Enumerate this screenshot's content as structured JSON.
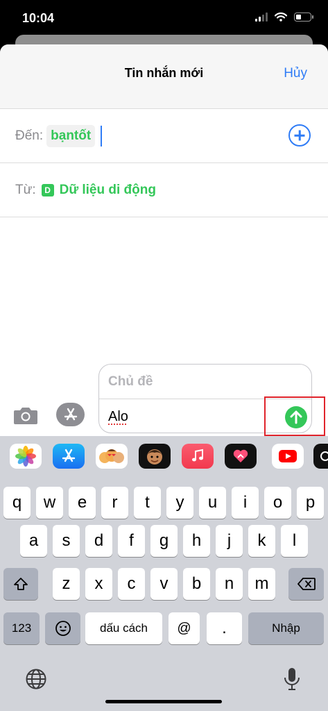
{
  "status_bar": {
    "time": "10:04"
  },
  "nav": {
    "title": "Tin nhắn mới",
    "cancel_label": "Hủy"
  },
  "to_field": {
    "label": "Đến:",
    "recipient": "bạntốt"
  },
  "from_field": {
    "label": "Từ:",
    "sim_badge": "D",
    "sim_name": "Dữ liệu di động"
  },
  "compose": {
    "subject_placeholder": "Chủ đề",
    "message_text": "Alo"
  },
  "keyboard": {
    "row1": [
      "q",
      "w",
      "e",
      "r",
      "t",
      "y",
      "u",
      "i",
      "o",
      "p"
    ],
    "row2": [
      "a",
      "s",
      "d",
      "f",
      "g",
      "h",
      "j",
      "k",
      "l"
    ],
    "row3": [
      "z",
      "x",
      "c",
      "v",
      "b",
      "n",
      "m"
    ],
    "numbers_label": "123",
    "space_label": "dấu cách",
    "at_label": "@",
    "dot_label": ".",
    "return_label": "Nhập"
  },
  "app_strip": [
    "photos-icon",
    "app-store-icon",
    "memoji-stickers-icon",
    "memoji-icon",
    "music-icon",
    "digital-touch-icon",
    "youtube-icon",
    "more-app-icon"
  ],
  "colors": {
    "accent_blue": "#2f7cf6",
    "imessage_green": "#34c759",
    "highlight_red": "#e0232b",
    "keyboard_bg": "#d1d3d9"
  }
}
